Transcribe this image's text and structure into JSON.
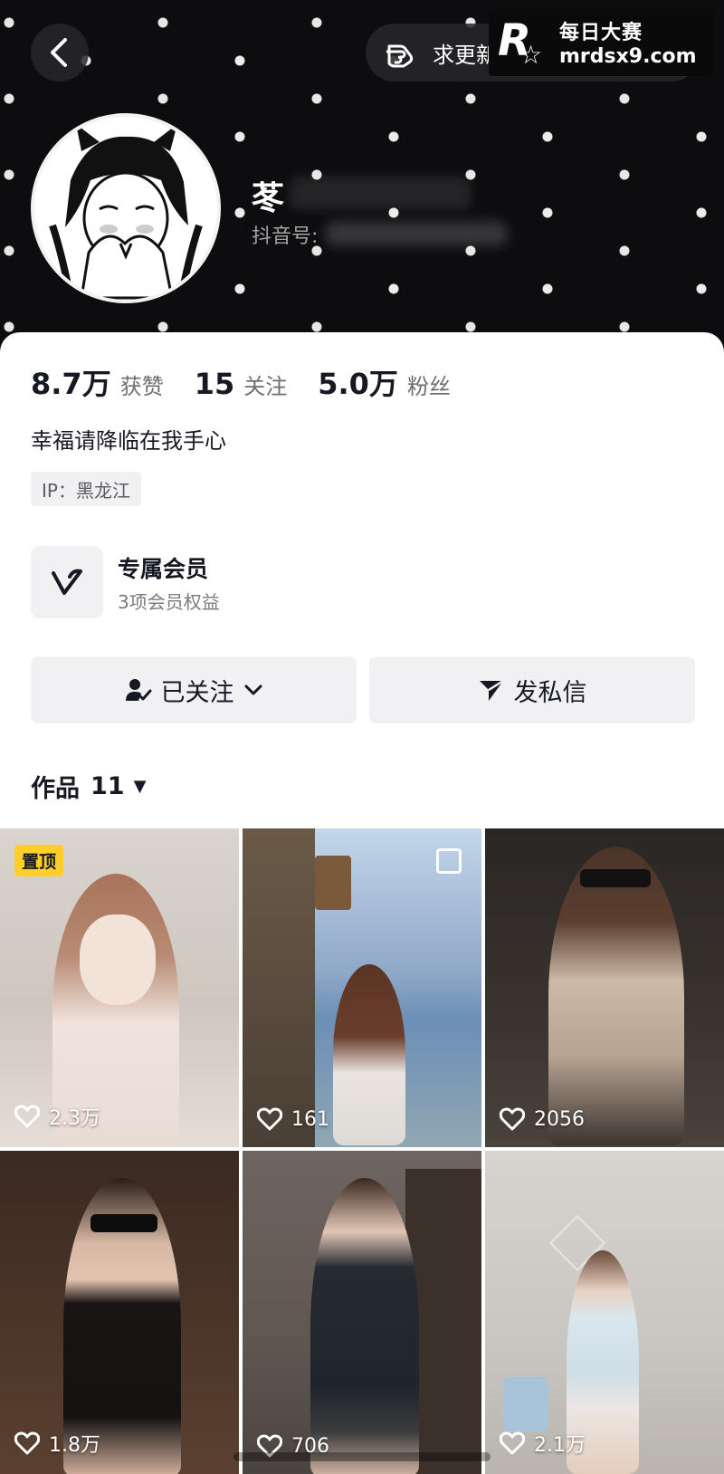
{
  "header": {
    "request_label": "求更新",
    "nickname": "苳",
    "douyin_id_label": "抖音号:",
    "watermark": {
      "logo_letter": "R",
      "line1": "每日大赛",
      "line2": "mrdsx9.com"
    }
  },
  "profile": {
    "stats": [
      {
        "value": "8.7万",
        "label": "获赞"
      },
      {
        "value": "15",
        "label": "关注"
      },
      {
        "value": "5.0万",
        "label": "粉丝"
      }
    ],
    "bio": "幸福请降临在我手心",
    "ip": "IP：黑龙江",
    "membership": {
      "title": "专属会员",
      "subtitle": "3项会员权益"
    },
    "buttons": {
      "follow": "已关注",
      "message": "发私信"
    },
    "works": {
      "label": "作品",
      "count": "11"
    }
  },
  "grid": {
    "pinned_label": "置顶",
    "items": [
      {
        "likes": "2.3万"
      },
      {
        "likes": "161"
      },
      {
        "likes": "2056"
      },
      {
        "likes": "1.8万"
      },
      {
        "likes": "706"
      },
      {
        "likes": "2.1万"
      }
    ]
  },
  "colors": {
    "header_bg": "#0d0d0f",
    "pin_bg": "#fecf2b",
    "button_bg": "#f1f1f3"
  }
}
